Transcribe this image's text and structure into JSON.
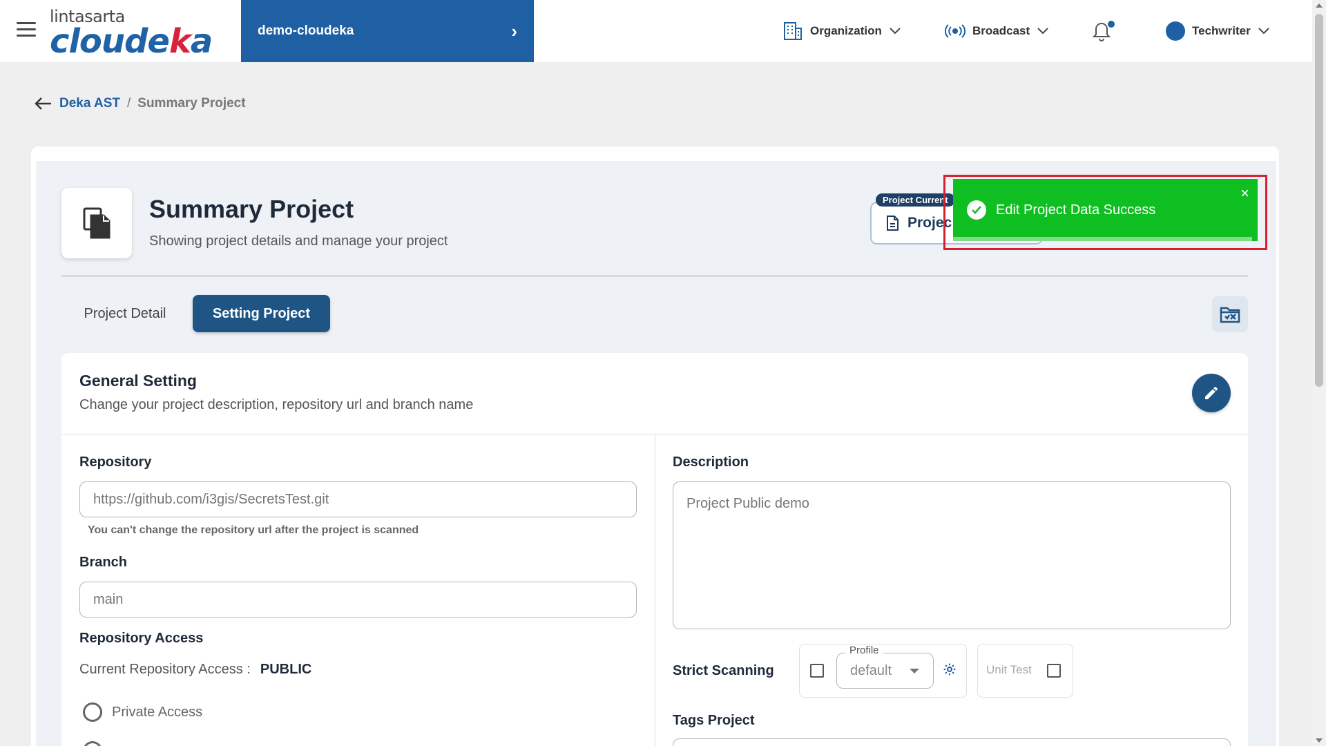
{
  "header": {
    "logo_top": "lintasarta",
    "logo_main": "cloude",
    "logo_accent": "k",
    "logo_end": "a",
    "project_name": "demo-cloudeka",
    "nav": {
      "organization": "Organization",
      "broadcast": "Broadcast",
      "user": "Techwriter"
    }
  },
  "breadcrumb": {
    "parent": "Deka AST",
    "separator": "/",
    "current": "Summary Project"
  },
  "page": {
    "title": "Summary Project",
    "subtitle": "Showing project details and manage your project",
    "project_current_tag": "Project Current",
    "project_current_value": "Projec"
  },
  "tabs": {
    "detail": "Project Detail",
    "setting": "Setting Project"
  },
  "general_setting": {
    "title": "General Setting",
    "subtitle": "Change your project description, repository url and branch name",
    "repository_label": "Repository",
    "repository_placeholder": "https://github.com/i3gis/SecretsTest.git",
    "repository_hint": "You can't change the repository url after the project is scanned",
    "branch_label": "Branch",
    "branch_placeholder": "main",
    "access_label": "Repository Access",
    "current_access_label": "Current Repository Access :",
    "current_access_value": "PUBLIC",
    "private_access": "Private Access",
    "description_label": "Description",
    "description_placeholder": "Project Public demo",
    "strict_scanning_label": "Strict Scanning",
    "profile_legend": "Profile",
    "profile_value": "default",
    "unit_test_label": "Unit Test",
    "tags_label": "Tags Project"
  },
  "toast": {
    "message": "Edit Project Data Success",
    "close": "×"
  },
  "colors": {
    "brand": "#1f5fa3",
    "active_tab": "#1f5585",
    "toast": "#0fbf21",
    "highlight": "#d6202f"
  }
}
